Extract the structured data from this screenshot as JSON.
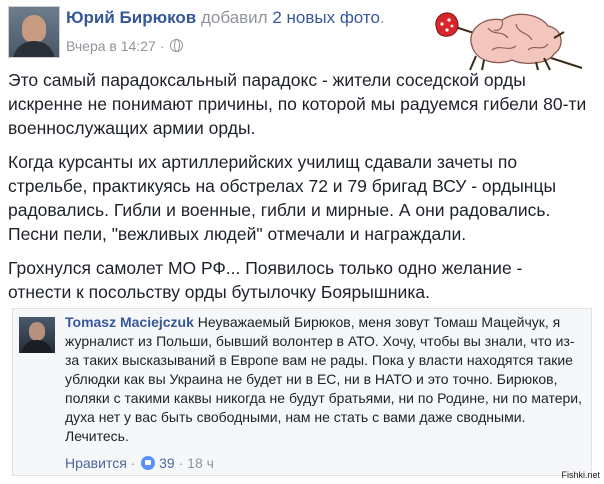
{
  "post": {
    "author": "Юрий Бирюков",
    "action_prefix": "добавил",
    "action_link": "2 новых фото",
    "action_suffix": ".",
    "time": "Вчера в 14:27",
    "separator": "·",
    "paragraphs": [
      "Это самый парадоксальный парадокс - жители соседской орды искренне не понимают причины, по которой мы радуемся гибели 80-ти военнослужащих армии орды.",
      "Когда курсанты их артиллерийских училищ сдавали зачеты по стрельбе, практикуясь на обстрелах 72 и 79 бригад ВСУ - ордынцы радовались. Гибли и военные, гибли и мирные. А они радовались. Песни пели, \"вежливых людей\" отмечали и награждали.",
      "Грохнулся самолет МО РФ... Появилось только одно желание - отнести к посольству орды бутылочку Боярышника."
    ]
  },
  "comment": {
    "author": "Tomasz Maciejczuk",
    "text": "Неуважаемый Бирюков, меня зовут Томаш Мацейчук, я журналист из Польши, бывший волонтер в АТО. Хочу, чтобы вы знали, что из-за таких высказываний в Европе вам не рады. Пока у власти находятся такие ублюдки как вы Украина не будет ни в ЕС, ни в НАТО и это точно. Бирюков, поляки с такими каквы никогда не будут братьями, ни по Родине, ни по матери, духа нет у вас быть свободными, нам не стать с вами даже сводными. Лечитесь.",
    "like_label": "Нравится",
    "dot": "·",
    "like_count": "39",
    "time": "18 ч"
  },
  "watermark": "Fishki.net",
  "icons": {
    "globe": "globe-icon",
    "like": "like-icon",
    "sticker": "brain-bindle-sticker"
  },
  "colors": {
    "link": "#365899",
    "meta": "#90949c",
    "text": "#1d2129",
    "like_blue": "#5890ff"
  }
}
